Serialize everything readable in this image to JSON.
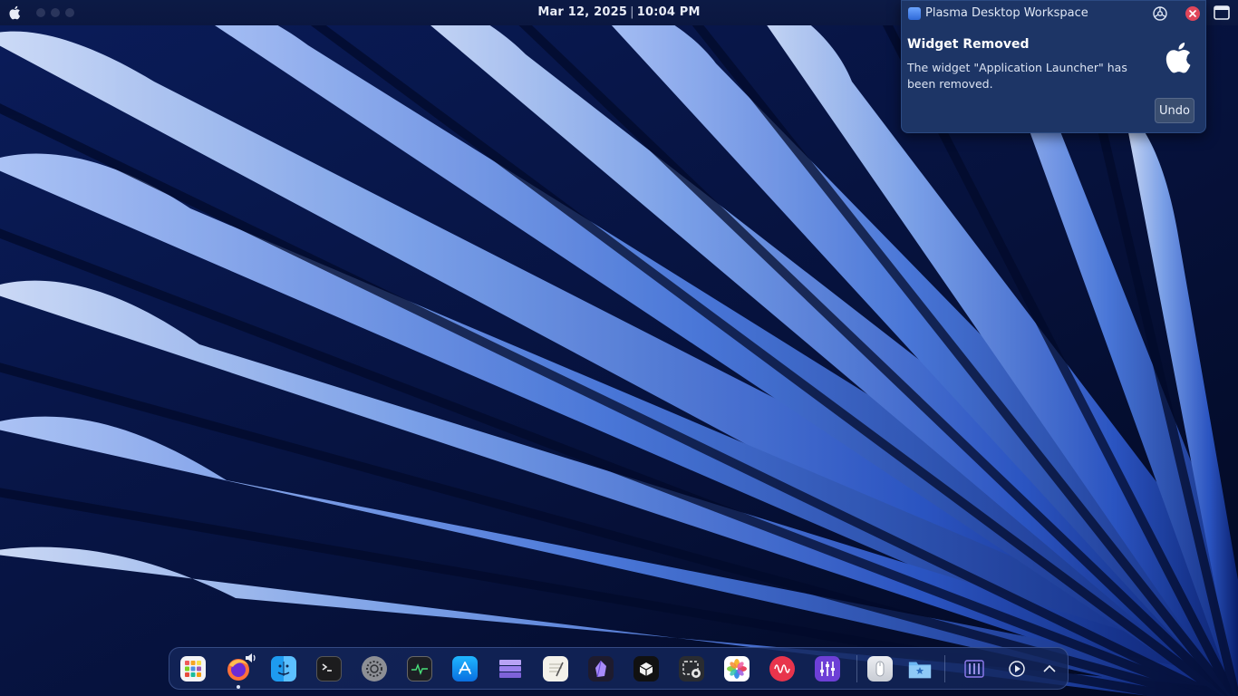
{
  "top_panel": {
    "date": "Mar 12, 2025",
    "separator": "|",
    "time": "10:04 PM"
  },
  "notification": {
    "app_name": "Plasma Desktop Workspace",
    "title": "Widget Removed",
    "body": "The widget \"Application Launcher\" has been removed.",
    "undo_label": "Undo"
  },
  "dock": {
    "items": [
      {
        "name": "launchpad-icon"
      },
      {
        "name": "firefox-icon",
        "running": true,
        "audio": true
      },
      {
        "name": "finder-icon"
      },
      {
        "name": "terminal-icon"
      },
      {
        "name": "system-settings-icon"
      },
      {
        "name": "activity-monitor-icon"
      },
      {
        "name": "app-store-icon"
      },
      {
        "name": "task-manager-icon"
      },
      {
        "name": "text-editor-icon"
      },
      {
        "name": "obsidian-icon"
      },
      {
        "name": "box-app-icon"
      },
      {
        "name": "screenshot-icon"
      },
      {
        "name": "photos-icon"
      },
      {
        "name": "audio-recorder-icon"
      },
      {
        "name": "mixer-icon"
      },
      {
        "name": "mouse-settings-icon"
      },
      {
        "name": "favorites-folder-icon"
      },
      {
        "name": "equalizer-icon"
      },
      {
        "name": "media-play-icon"
      },
      {
        "name": "chevron-up-icon"
      }
    ]
  },
  "colors": {
    "panel": "#0c1a45",
    "notification_bg": "#1d3566",
    "close": "#e0465a",
    "dock_bg": "#14265a"
  }
}
